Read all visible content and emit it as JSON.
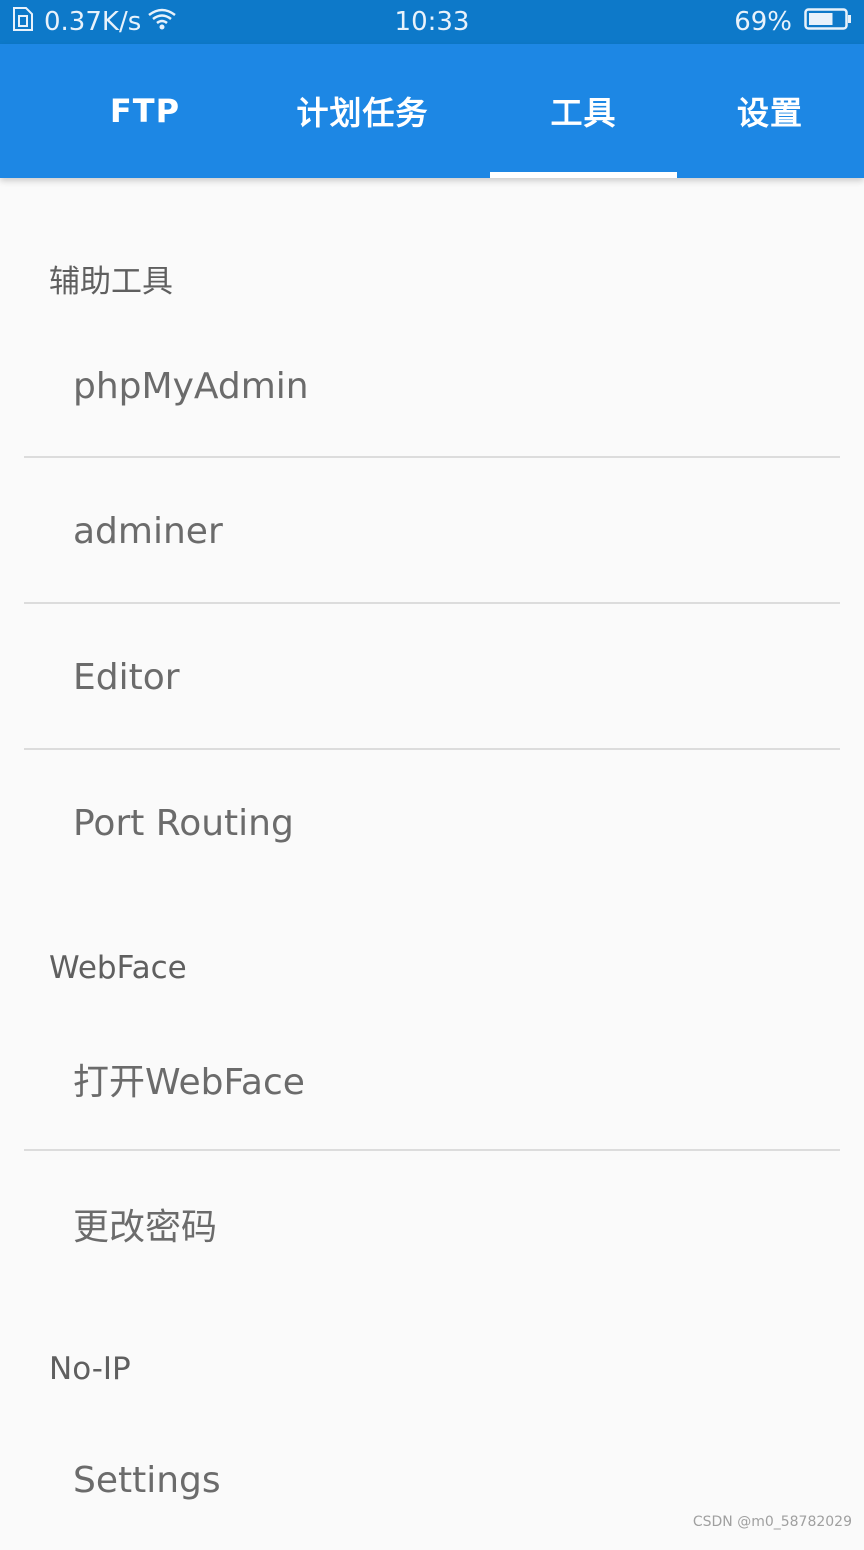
{
  "status_bar": {
    "net_speed": "0.37K/s",
    "time": "10:33",
    "battery_percent": "69%",
    "battery_level": 0.69,
    "icons": [
      "sim-icon",
      "wifi-icon",
      "battery-icon"
    ]
  },
  "tabs": [
    {
      "label": "FTP",
      "active": false
    },
    {
      "label": "计划任务",
      "active": false
    },
    {
      "label": "工具",
      "active": true
    },
    {
      "label": "设置",
      "active": false
    }
  ],
  "sections": {
    "aux_tools": {
      "header": "辅助工具",
      "items": [
        "phpMyAdmin",
        "adminer",
        "Editor",
        "Port Routing"
      ]
    },
    "webface": {
      "header": "WebFace",
      "items": [
        "打开WebFace",
        "更改密码"
      ]
    },
    "noip": {
      "header": "No-IP",
      "items": [
        "Settings"
      ]
    }
  },
  "watermark": "CSDN @m0_58782029",
  "colors": {
    "status_bar_bg": "#0d79c9",
    "tab_bar_bg": "#1d87e4",
    "page_bg": "#fafafa",
    "indicator": "#ffffff"
  }
}
